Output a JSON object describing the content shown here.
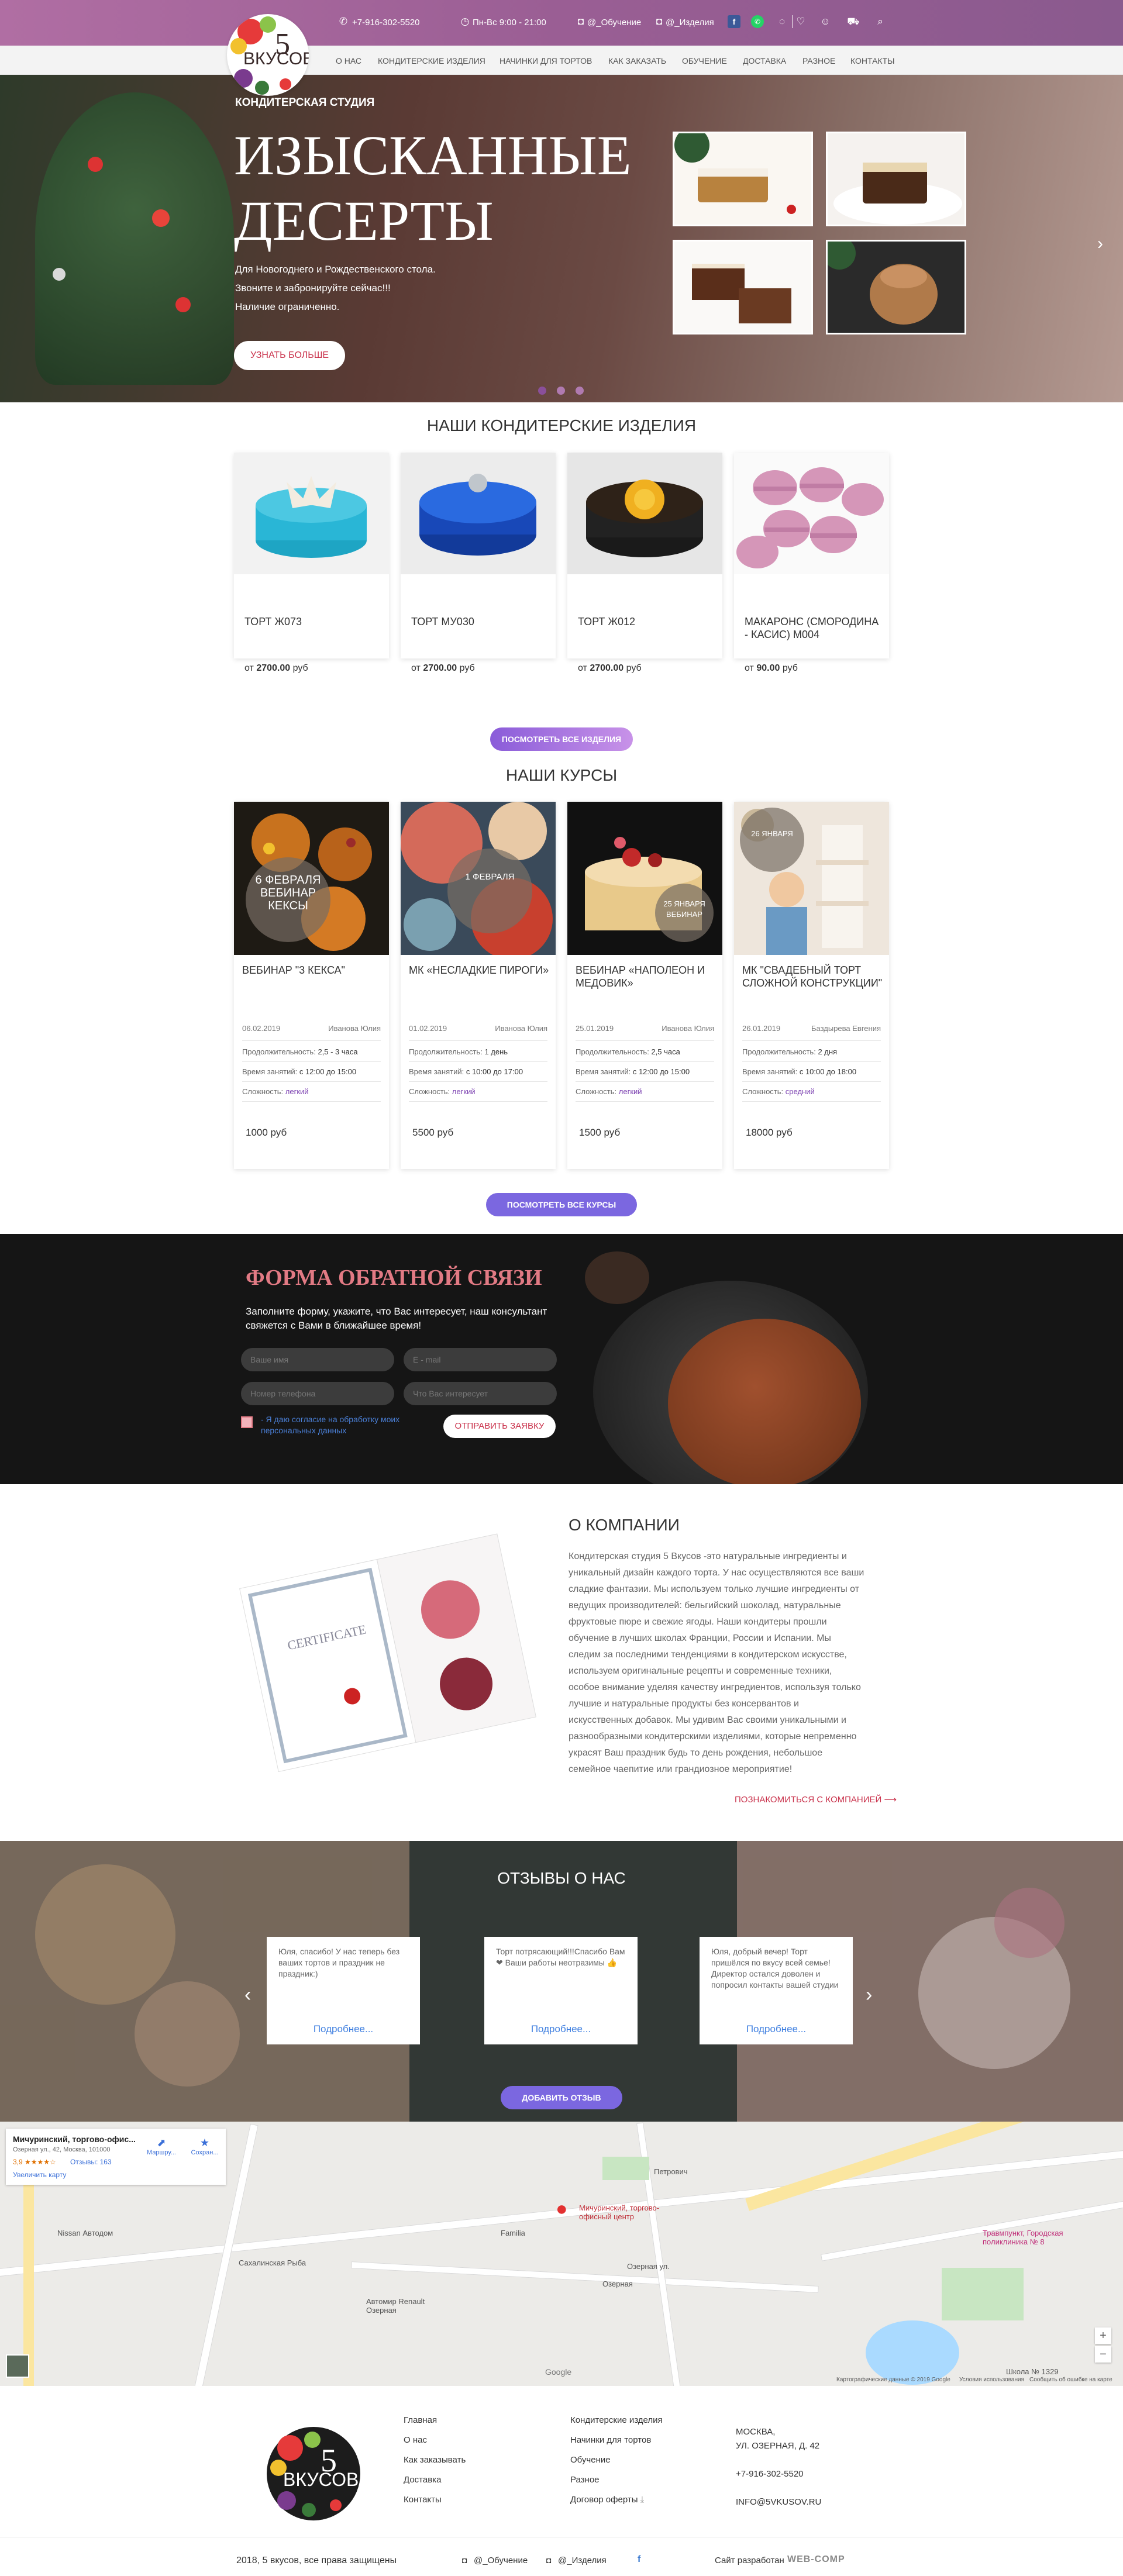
{
  "header": {
    "phone": "+7-916-302-5520",
    "hours": "Пн-Вс 9:00 - 21:00",
    "insta1": "@_Обучение",
    "insta2": "@_Изделия",
    "logo_text": "ВКУСОВ",
    "logo_number": "5"
  },
  "nav": [
    "О НАС",
    "КОНДИТЕРСКИЕ ИЗДЕЛИЯ",
    "НАЧИНКИ ДЛЯ ТОРТОВ",
    "КАК ЗАКАЗАТЬ",
    "ОБУЧЕНИЕ",
    "ДОСТАВКА",
    "РАЗНОЕ",
    "КОНТАКТЫ"
  ],
  "hero": {
    "subtitle": "Кондитерская студия",
    "title_line1": "Изысканные",
    "title_line2": "десерты",
    "line1": "Для Новогоднего и Рождественского стола.",
    "line2": "Звоните и забронируйте сейчас!!!",
    "line3": "Наличие ограниченно.",
    "button": "Узнать больше",
    "slides": 3,
    "active_slide": 1
  },
  "products": {
    "title": "Наши кондитерские изделия",
    "items": [
      {
        "name": "ТОРТ Ж073",
        "price_prefix": "от",
        "price": "2700.00",
        "currency": "руб"
      },
      {
        "name": "ТОРТ МУ030",
        "price_prefix": "от",
        "price": "2700.00",
        "currency": "руб"
      },
      {
        "name": "ТОРТ Ж012",
        "price_prefix": "от",
        "price": "2700.00",
        "currency": "руб"
      },
      {
        "name": "МАКАРОНС (СМОРОДИНА - КАСИС) М004",
        "price_prefix": "от",
        "price": "90.00",
        "currency": "руб"
      }
    ],
    "button": "Посмотреть все изделия"
  },
  "courses": {
    "title": "Наши курсы",
    "items": [
      {
        "badge": "6 ФЕВРАЛЯ ВЕБИНАР КЕКСЫ",
        "name": "ВЕБИНАР \"3 КЕКСА\"",
        "date": "06.02.2019",
        "author": "Иванова Юлия",
        "duration_label": "Продолжительность:",
        "duration": "2,5 - 3 часа",
        "time_label": "Время занятий:",
        "time": "с 12:00 до 15:00",
        "level_label": "Сложность:",
        "level": "легкий",
        "price": "1000 руб"
      },
      {
        "badge": "1 ФЕВРАЛЯ",
        "name": "МК «НЕСЛАДКИЕ ПИРОГИ»",
        "date": "01.02.2019",
        "author": "Иванова Юлия",
        "duration_label": "Продолжительность:",
        "duration": "1 день",
        "time_label": "Время занятий:",
        "time": "с 10:00 до 17:00",
        "level_label": "Сложность:",
        "level": "легкий",
        "price": "5500 руб"
      },
      {
        "badge": "25 ЯНВАРЯ ВЕБИНАР",
        "name": "ВЕБИНАР «НАПОЛЕОН И МЕДОВИК»",
        "date": "25.01.2019",
        "author": "Иванова Юлия",
        "duration_label": "Продолжительность:",
        "duration": "2,5 часа",
        "time_label": "Время занятий:",
        "time": "с 12:00 до 15:00",
        "level_label": "Сложность:",
        "level": "легкий",
        "price": "1500 руб"
      },
      {
        "badge": "26 ЯНВАРЯ",
        "name": "МК \"СВАДЕБНЫЙ ТОРТ СЛОЖНОЙ КОНСТРУКЦИИ\"",
        "date": "26.01.2019",
        "author": "Баздырева Евгения",
        "duration_label": "Продолжительность:",
        "duration": "2 дня",
        "time_label": "Время занятий:",
        "time": "с 10:00 до 18:00",
        "level_label": "Сложность:",
        "level": "средний",
        "price": "18000 руб"
      }
    ],
    "button": "Посмотреть все курсы"
  },
  "form": {
    "title": "Форма обратной связи",
    "text": "Заполните форму, укажите, что Вас интересует, наш консультант свяжется с Вами в ближайшее время!",
    "name_placeholder": "Ваше имя",
    "email_placeholder": "E - mail",
    "phone_placeholder": "Номер телефона",
    "interest_placeholder": "Что Вас интересует",
    "agree": "- Я даю согласие на обработку моих персональных данных",
    "button": "Отправить заявку"
  },
  "about": {
    "title": "О компании",
    "text": "Кондитерская студия 5 Вкусов -это натуральные ингредиенты и уникальный дизайн каждого торта. У нас осуществляются все ваши сладкие фантазии. Мы используем только лучшие ингредиенты от ведущих производителей: бельгийский шоколад, натуральные фруктовые пюре и свежие ягоды. Наши кондитеры прошли обучение в лучших школах Франции, России и Испании. Мы следим за последними тенденциями в кондитерском искусстве, используем оригинальные рецепты и современные техники, особое внимание уделяя качеству ингредиентов, используя только лучшие и натуральные продукты без консервантов и искусственных добавок. Мы удивим Вас своими уникальными и разнообразными кондитерскими изделиями, которые непременно украсят Ваш праздник будь то день рождения, небольшое семейное чаепитие или грандиозное мероприятие!",
    "link": "Познакомиться с компанией",
    "cert_word": "CERTIFICATE"
  },
  "reviews": {
    "title": "Отзывы о нас",
    "items": [
      {
        "text": "Юля, спасибо! У нас теперь без ваших тортов и праздник не праздник:)",
        "more": "Подробнее..."
      },
      {
        "text": "Торт потрясающий!!!Спасибо Вам❤ Ваши работы неотразимы 👍",
        "more": "Подробнее..."
      },
      {
        "text": "Юля, добрый вечер! Торт пришёлся по вкусу всей семье! Директор остался доволен и попросил контакты вашей студии",
        "more": "Подробнее..."
      }
    ],
    "button": "Добавить отзыв"
  },
  "map": {
    "place_name": "Мичуринский, торгово-офис...",
    "place_addr": "Озерная ул., 42, Москва, 101000",
    "rating": "3,9",
    "reviews_link": "Отзывы: 163",
    "bigger_map": "Увеличить карту",
    "route_label": "Маршру...",
    "save_label": "Сохран...",
    "pin_label": "Мичуринский, торгово-офисный центр",
    "labels": [
      "Nissan Автодом",
      "Сахалинская Рыба",
      "Familia",
      "Петрович",
      "Озерная",
      "Озерная ул.",
      "Автомир Renault Озерная",
      "Травмпункт, Городская поликлиника № 8",
      "Школа № 1329",
      "Google",
      "Картографические данные © 2019 Google",
      "Условия использования",
      "Сообщить об ошибке на карте"
    ],
    "zoom_in": "+",
    "zoom_out": "−"
  },
  "footer": {
    "col1": [
      "Главная",
      "О нас",
      "Как заказывать",
      "Доставка",
      "Контакты"
    ],
    "col2": [
      "Кондитерские изделия",
      "Начинки для тортов",
      "Обучение",
      "Разное",
      "Договор оферты"
    ],
    "city": "МОСКВА,",
    "street": "УЛ. ОЗЕРНАЯ, Д. 42",
    "phone": "+7-916-302-5520",
    "email": "INFO@5VKUSOV.RU",
    "copyright": "2018, 5 вкусов, все права защищены",
    "insta1": "@_Обучение",
    "insta2": "@_Изделия",
    "dev_label": "Сайт разработан",
    "dev_name": "WEB-COMP"
  }
}
